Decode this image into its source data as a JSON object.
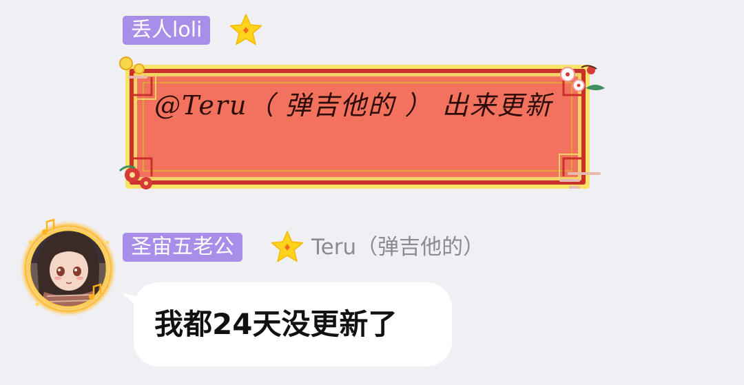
{
  "messages": [
    {
      "sender": "丢人loli",
      "text": "@Teru（ 弹吉他的 ） 出来更新"
    },
    {
      "sender": "圣宙五老公",
      "reply_to": "Teru（弹吉他的）",
      "text": "我都24天没更新了"
    }
  ],
  "icons": {
    "badge_star": "star-icon",
    "avatar": "avatar"
  },
  "colors": {
    "background": "#efeff4",
    "name_badge": "#a98ee9",
    "card_red": "#f2725e",
    "card_gold": "#f7d64b",
    "bubble": "#ffffff"
  }
}
